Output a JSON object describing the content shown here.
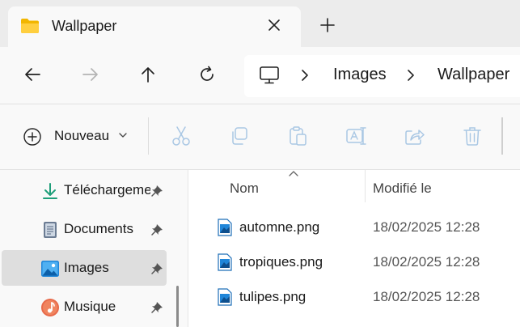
{
  "tab": {
    "title": "Wallpaper",
    "icon": "folder-icon"
  },
  "breadcrumb": {
    "icon": "this-pc-icon",
    "items": [
      "Images",
      "Wallpaper"
    ]
  },
  "toolbar": {
    "new_label": "Nouveau",
    "actions": [
      "cut",
      "copy",
      "paste",
      "rename",
      "share",
      "delete"
    ]
  },
  "sidebar": {
    "items": [
      {
        "label": "Téléchargements",
        "icon": "download-icon",
        "pinned": true,
        "selected": false
      },
      {
        "label": "Documents",
        "icon": "documents-icon",
        "pinned": true,
        "selected": false
      },
      {
        "label": "Images",
        "icon": "images-icon",
        "pinned": true,
        "selected": true
      },
      {
        "label": "Musique",
        "icon": "music-icon",
        "pinned": true,
        "selected": false
      }
    ]
  },
  "file_list": {
    "columns": [
      "Nom",
      "Modifié le"
    ],
    "sorted_by": "Nom",
    "files": [
      {
        "name": "automne.png",
        "modified": "18/02/2025 12:28"
      },
      {
        "name": "tropiques.png",
        "modified": "18/02/2025 12:28"
      },
      {
        "name": "tulipes.png",
        "modified": "18/02/2025 12:28"
      }
    ]
  },
  "colors": {
    "accent": "#0067c0",
    "disabled_icon": "#a9c7e4",
    "selection": "#dedede"
  }
}
